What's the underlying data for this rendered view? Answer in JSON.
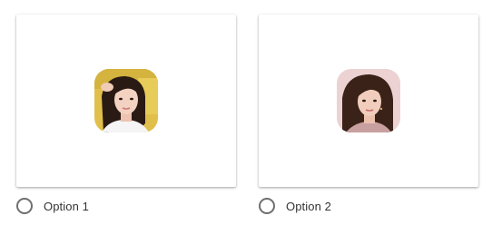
{
  "options": [
    {
      "label": "Option 1",
      "selected": false,
      "image": {
        "icon": "portrait-photo",
        "background": "#e0c04a",
        "hair": "#2a1a14",
        "skin": "#f3d2c1",
        "clothing": "#f5f5f5"
      }
    },
    {
      "label": "Option 2",
      "selected": false,
      "image": {
        "icon": "portrait-photo",
        "background": "#ecd2d2",
        "hair": "#3a2218",
        "skin": "#f1cdbd",
        "clothing": "#c9a0a0"
      }
    }
  ],
  "colors": {
    "radio_border": "#6f6f6f",
    "label_text": "#333333",
    "card_background": "#ffffff"
  }
}
